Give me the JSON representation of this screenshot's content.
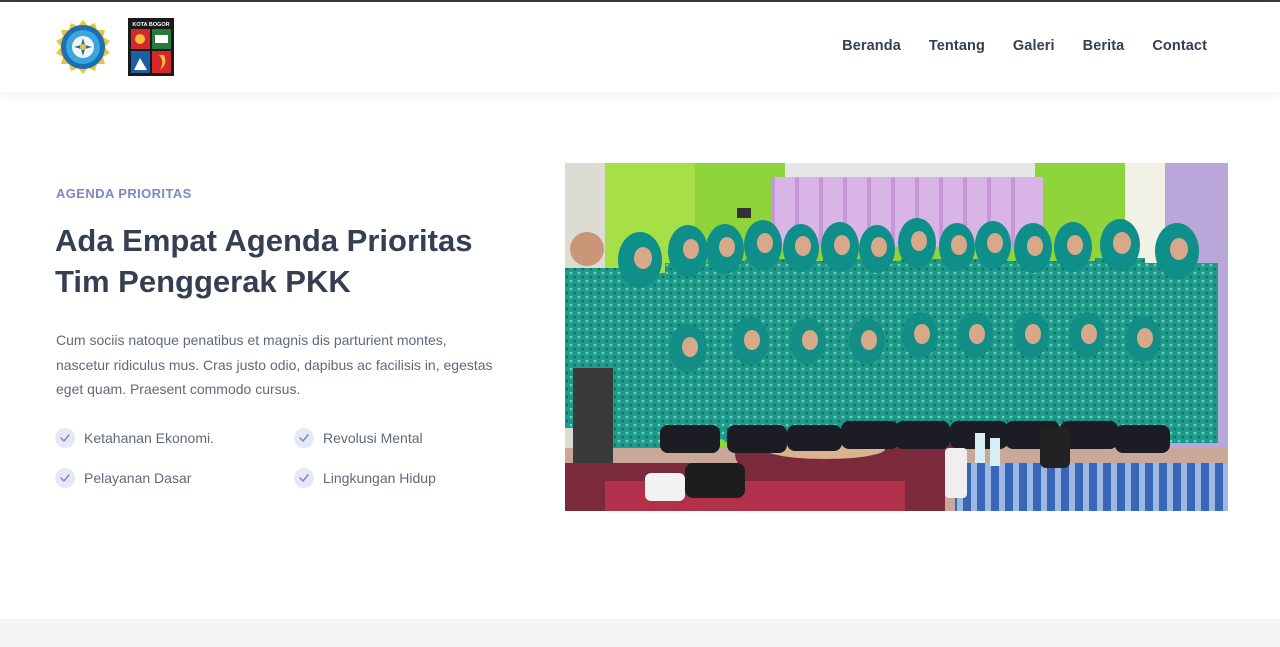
{
  "header": {
    "logo_kota_text": "KOTA BOGOR",
    "nav": [
      "Beranda",
      "Tentang",
      "Galeri",
      "Berita",
      "Contact"
    ]
  },
  "hero": {
    "eyebrow": "AGENDA PRIORITAS",
    "title": "Ada Empat Agenda Prioritas Tim Penggerak PKK",
    "description": "Cum sociis natoque penatibus et magnis dis parturient montes, nascetur ridiculus mus. Cras justo odio, dapibus ac facilisis in, egestas eget quam. Praesent commodo cursus.",
    "features": [
      "Ketahanan Ekonomi.",
      "Revolusi Mental",
      "Pelayanan Dasar",
      "Lingkungan Hidup"
    ]
  },
  "icons": {
    "feature": "check-icon"
  },
  "colors": {
    "accent": "#7c88c5",
    "heading": "#343f52",
    "body": "#60697b",
    "check_bg": "#e6e9f5"
  }
}
